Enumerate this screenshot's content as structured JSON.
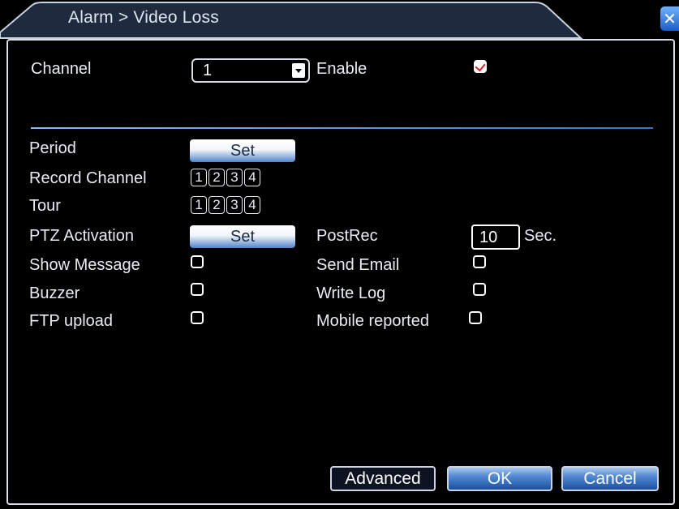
{
  "window": {
    "title": "Alarm > Video Loss",
    "close_icon": "close-icon"
  },
  "form": {
    "channel": {
      "label": "Channel",
      "value": "1"
    },
    "enable": {
      "label": "Enable",
      "checked": true
    },
    "period": {
      "label": "Period",
      "button": "Set"
    },
    "record_channel": {
      "label": "Record Channel",
      "items": [
        "1",
        "2",
        "3",
        "4"
      ]
    },
    "tour": {
      "label": "Tour",
      "items": [
        "1",
        "2",
        "3",
        "4"
      ]
    },
    "ptz_activation": {
      "label": "PTZ Activation",
      "button": "Set"
    },
    "postrec": {
      "label": "PostRec",
      "value": "10",
      "unit": "Sec."
    },
    "show_message": {
      "label": "Show Message",
      "checked": false
    },
    "send_email": {
      "label": "Send Email",
      "checked": false
    },
    "buzzer": {
      "label": "Buzzer",
      "checked": false
    },
    "write_log": {
      "label": "Write Log",
      "checked": false
    },
    "ftp_upload": {
      "label": "FTP upload",
      "checked": false
    },
    "mobile_reported": {
      "label": "Mobile reported",
      "checked": false
    }
  },
  "buttons": {
    "advanced": "Advanced",
    "ok": "OK",
    "cancel": "Cancel"
  },
  "colors": {
    "accent": "#3c74c4",
    "tab_fill": "#243046",
    "check_mark": "#e02020"
  }
}
